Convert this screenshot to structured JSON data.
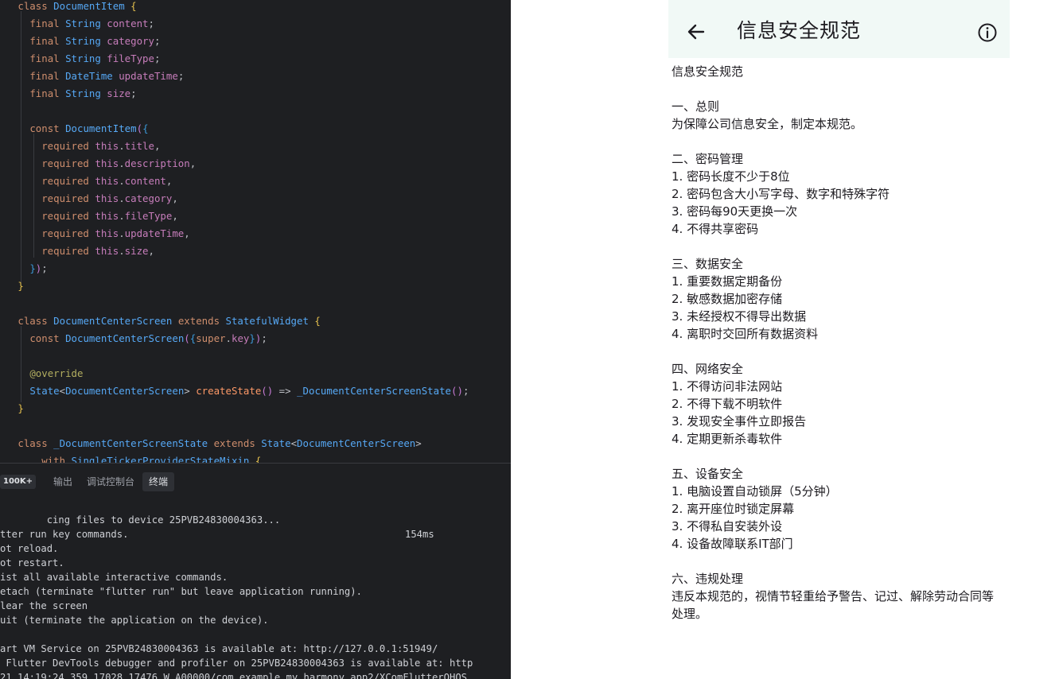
{
  "ide": {
    "code_lines": [
      {
        "indent": "  ",
        "parts": [
          [
            "kw",
            "class "
          ],
          [
            "ty",
            "DocumentItem "
          ],
          [
            "br",
            "{"
          ]
        ]
      },
      {
        "indent": "    ",
        "parts": [
          [
            "kw",
            "final "
          ],
          [
            "ty",
            "String "
          ],
          [
            "pr",
            "content"
          ],
          [
            "cs",
            ";"
          ]
        ]
      },
      {
        "indent": "    ",
        "parts": [
          [
            "kw",
            "final "
          ],
          [
            "ty",
            "String "
          ],
          [
            "pr",
            "category"
          ],
          [
            "cs",
            ";"
          ]
        ]
      },
      {
        "indent": "    ",
        "parts": [
          [
            "kw",
            "final "
          ],
          [
            "ty",
            "String "
          ],
          [
            "pr",
            "fileType"
          ],
          [
            "cs",
            ";"
          ]
        ]
      },
      {
        "indent": "    ",
        "parts": [
          [
            "kw",
            "final "
          ],
          [
            "ty",
            "DateTime "
          ],
          [
            "pr",
            "updateTime"
          ],
          [
            "cs",
            ";"
          ]
        ]
      },
      {
        "indent": "    ",
        "parts": [
          [
            "kw",
            "final "
          ],
          [
            "ty",
            "String "
          ],
          [
            "pr",
            "size"
          ],
          [
            "cs",
            ";"
          ]
        ]
      },
      {
        "indent": "",
        "parts": []
      },
      {
        "indent": "    ",
        "parts": [
          [
            "kw",
            "const "
          ],
          [
            "fn",
            "DocumentItem"
          ],
          [
            "br2",
            "("
          ],
          [
            "br3",
            "{"
          ]
        ]
      },
      {
        "indent": "      ",
        "parts": [
          [
            "kw",
            "required "
          ],
          [
            "th",
            "this"
          ],
          [
            "cs",
            "."
          ],
          [
            "pr",
            "title"
          ],
          [
            "cs",
            ","
          ]
        ]
      },
      {
        "indent": "      ",
        "parts": [
          [
            "kw",
            "required "
          ],
          [
            "th",
            "this"
          ],
          [
            "cs",
            "."
          ],
          [
            "pr",
            "description"
          ],
          [
            "cs",
            ","
          ]
        ]
      },
      {
        "indent": "      ",
        "parts": [
          [
            "kw",
            "required "
          ],
          [
            "th",
            "this"
          ],
          [
            "cs",
            "."
          ],
          [
            "pr",
            "content"
          ],
          [
            "cs",
            ","
          ]
        ]
      },
      {
        "indent": "      ",
        "parts": [
          [
            "kw",
            "required "
          ],
          [
            "th",
            "this"
          ],
          [
            "cs",
            "."
          ],
          [
            "pr",
            "category"
          ],
          [
            "cs",
            ","
          ]
        ]
      },
      {
        "indent": "      ",
        "parts": [
          [
            "kw",
            "required "
          ],
          [
            "th",
            "this"
          ],
          [
            "cs",
            "."
          ],
          [
            "pr",
            "fileType"
          ],
          [
            "cs",
            ","
          ]
        ]
      },
      {
        "indent": "      ",
        "parts": [
          [
            "kw",
            "required "
          ],
          [
            "th",
            "this"
          ],
          [
            "cs",
            "."
          ],
          [
            "pr",
            "updateTime"
          ],
          [
            "cs",
            ","
          ]
        ]
      },
      {
        "indent": "      ",
        "parts": [
          [
            "kw",
            "required "
          ],
          [
            "th",
            "this"
          ],
          [
            "cs",
            "."
          ],
          [
            "pr",
            "size"
          ],
          [
            "cs",
            ","
          ]
        ]
      },
      {
        "indent": "    ",
        "parts": [
          [
            "br3",
            "}"
          ],
          [
            "br2",
            ")"
          ],
          [
            "cs",
            ";"
          ]
        ]
      },
      {
        "indent": "  ",
        "parts": [
          [
            "br",
            "}"
          ]
        ]
      },
      {
        "indent": "",
        "parts": []
      },
      {
        "indent": "  ",
        "parts": [
          [
            "kw",
            "class "
          ],
          [
            "ty",
            "DocumentCenterScreen "
          ],
          [
            "kw",
            "extends "
          ],
          [
            "ty",
            "StatefulWidget "
          ],
          [
            "br",
            "{"
          ]
        ]
      },
      {
        "indent": "    ",
        "parts": [
          [
            "kw",
            "const "
          ],
          [
            "fn",
            "DocumentCenterScreen"
          ],
          [
            "br2",
            "("
          ],
          [
            "br3",
            "{"
          ],
          [
            "kw",
            "super"
          ],
          [
            "cs",
            "."
          ],
          [
            "pr",
            "key"
          ],
          [
            "br3",
            "}"
          ],
          [
            "br2",
            ")"
          ],
          [
            "cs",
            ";"
          ]
        ]
      },
      {
        "indent": "",
        "parts": []
      },
      {
        "indent": "    ",
        "parts": [
          [
            "an",
            "@override"
          ]
        ]
      },
      {
        "indent": "    ",
        "parts": [
          [
            "ty",
            "State"
          ],
          [
            "cs",
            "<"
          ],
          [
            "ty",
            "DocumentCenterScreen"
          ],
          [
            "cs",
            "> "
          ],
          [
            "orange",
            "createState"
          ],
          [
            "br2",
            "("
          ],
          [
            "br2",
            ")"
          ],
          [
            "cs",
            " => "
          ],
          [
            "fn",
            "_DocumentCenterScreenState"
          ],
          [
            "br2",
            "("
          ],
          [
            "br2",
            ")"
          ],
          [
            "cs",
            ";"
          ]
        ]
      },
      {
        "indent": "  ",
        "parts": [
          [
            "br",
            "}"
          ]
        ]
      },
      {
        "indent": "",
        "parts": []
      },
      {
        "indent": "  ",
        "parts": [
          [
            "kw",
            "class "
          ],
          [
            "ty",
            "_DocumentCenterScreenState "
          ],
          [
            "kw",
            "extends "
          ],
          [
            "ty",
            "State"
          ],
          [
            "cs",
            "<"
          ],
          [
            "ty",
            "DocumentCenterScreen"
          ],
          [
            "cs",
            ">"
          ]
        ]
      },
      {
        "indent": "      ",
        "parts": [
          [
            "kw",
            "with "
          ],
          [
            "ty",
            "SingleTickerProviderStateMixin "
          ],
          [
            "br",
            "{"
          ]
        ]
      }
    ],
    "panel": {
      "badge": "100K+",
      "tabs": [
        "输出",
        "调试控制台",
        "终端"
      ],
      "active_tab": "终端"
    },
    "terminal": {
      "sync_line": "cing files to device 25PVB24830004363...",
      "sync_time": "154ms",
      "lines": [
        "",
        "tter run key commands.",
        "ot reload.",
        "ot restart.",
        "ist all available interactive commands.",
        "etach (terminate \"flutter run\" but leave application running).",
        "lear the screen",
        "uit (terminate the application on the device).",
        "",
        "art VM Service on 25PVB24830004363 is available at: http://127.0.0.1:51949/",
        " Flutter DevTools debugger and profiler on 25PVB24830004363 is available at: http",
        "21 14:19:24.359 17028 17476 W A00000/com.example.my_harmony_app2/XComFlutterOHOS"
      ]
    }
  },
  "app": {
    "title": "信息安全规范",
    "back_icon": "arrow-back-icon",
    "info_icon": "info-outline-icon",
    "appbar_color": "#f1f9f6",
    "document_lines": [
      "信息安全规范",
      "",
      "一、总则",
      "为保障公司信息安全，制定本规范。",
      "",
      "二、密码管理",
      "1. 密码长度不少于8位",
      "2. 密码包含大小写字母、数字和特殊字符",
      "3. 密码每90天更换一次",
      "4. 不得共享密码",
      "",
      "三、数据安全",
      "1. 重要数据定期备份",
      "2. 敏感数据加密存储",
      "3. 未经授权不得导出数据",
      "4. 离职时交回所有数据资料",
      "",
      "四、网络安全",
      "1. 不得访问非法网站",
      "2. 不得下载不明软件",
      "3. 发现安全事件立即报告",
      "4. 定期更新杀毒软件",
      "",
      "五、设备安全",
      "1. 电脑设置自动锁屏（5分钟）",
      "2. 离开座位时锁定屏幕",
      "3. 不得私自安装外设",
      "4. 设备故障联系IT部门",
      "",
      "六、违规处理",
      "违反本规范的，视情节轻重给予警告、记过、解除劳动合同等",
      "处理。"
    ]
  }
}
